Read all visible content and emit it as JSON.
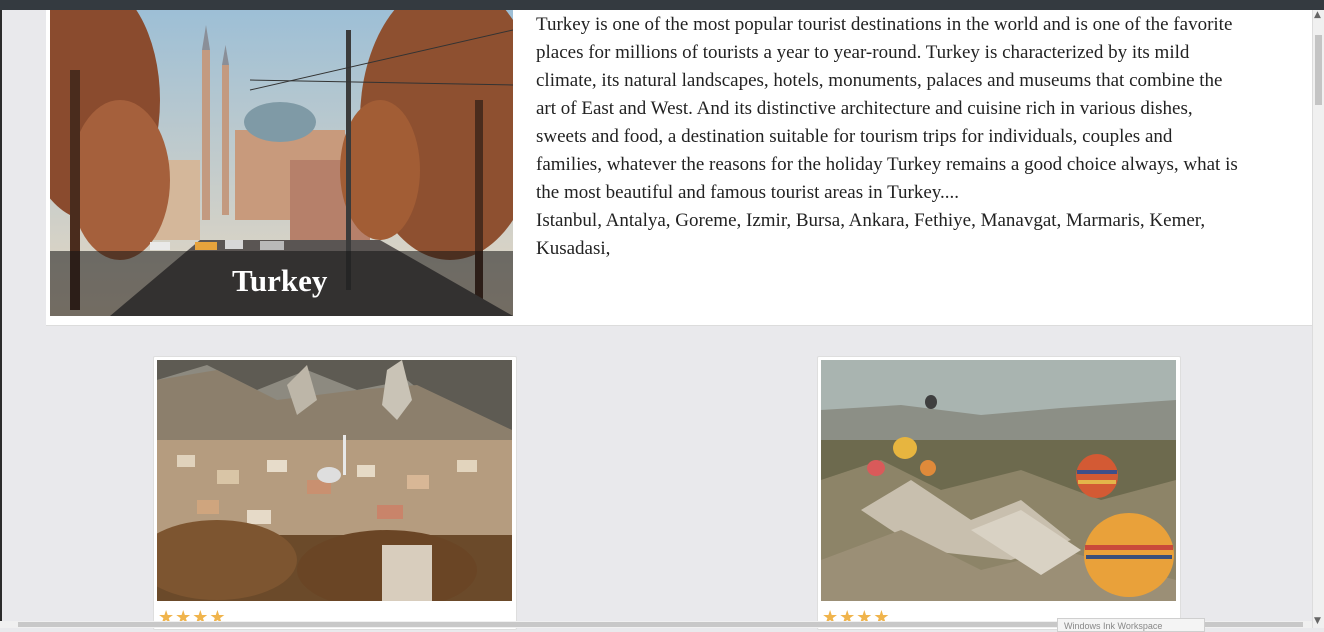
{
  "hero": {
    "title": "Turkey",
    "description": "Turkey is one of the most popular tourist destinations in the world and is one of the favorite places for millions of tourists a year to year-round. Turkey is characterized by its mild climate, its natural landscapes, hotels, monuments, palaces and museums that combine the art of East and West. And its distinctive architecture and cuisine rich in various dishes, sweets and food, a destination suitable for tourism trips for individuals, couples and families, whatever the reasons for the holiday Turkey remains a good choice always, what is the most beautiful and famous tourist areas in Turkey....",
    "places": "Istanbul, Antalya, Goreme, Izmir, Bursa, Ankara, Fethiye, Manavgat, Marmaris, Kemer, Kusadasi,"
  },
  "cards": [
    {
      "rating": "★★★★"
    },
    {
      "rating": "★★★★"
    }
  ],
  "taskbar": {
    "label": "Windows Ink Workspace"
  },
  "colors": {
    "star": "#f0b44c",
    "topbar": "#343a40",
    "background": "#e9e9ec"
  }
}
